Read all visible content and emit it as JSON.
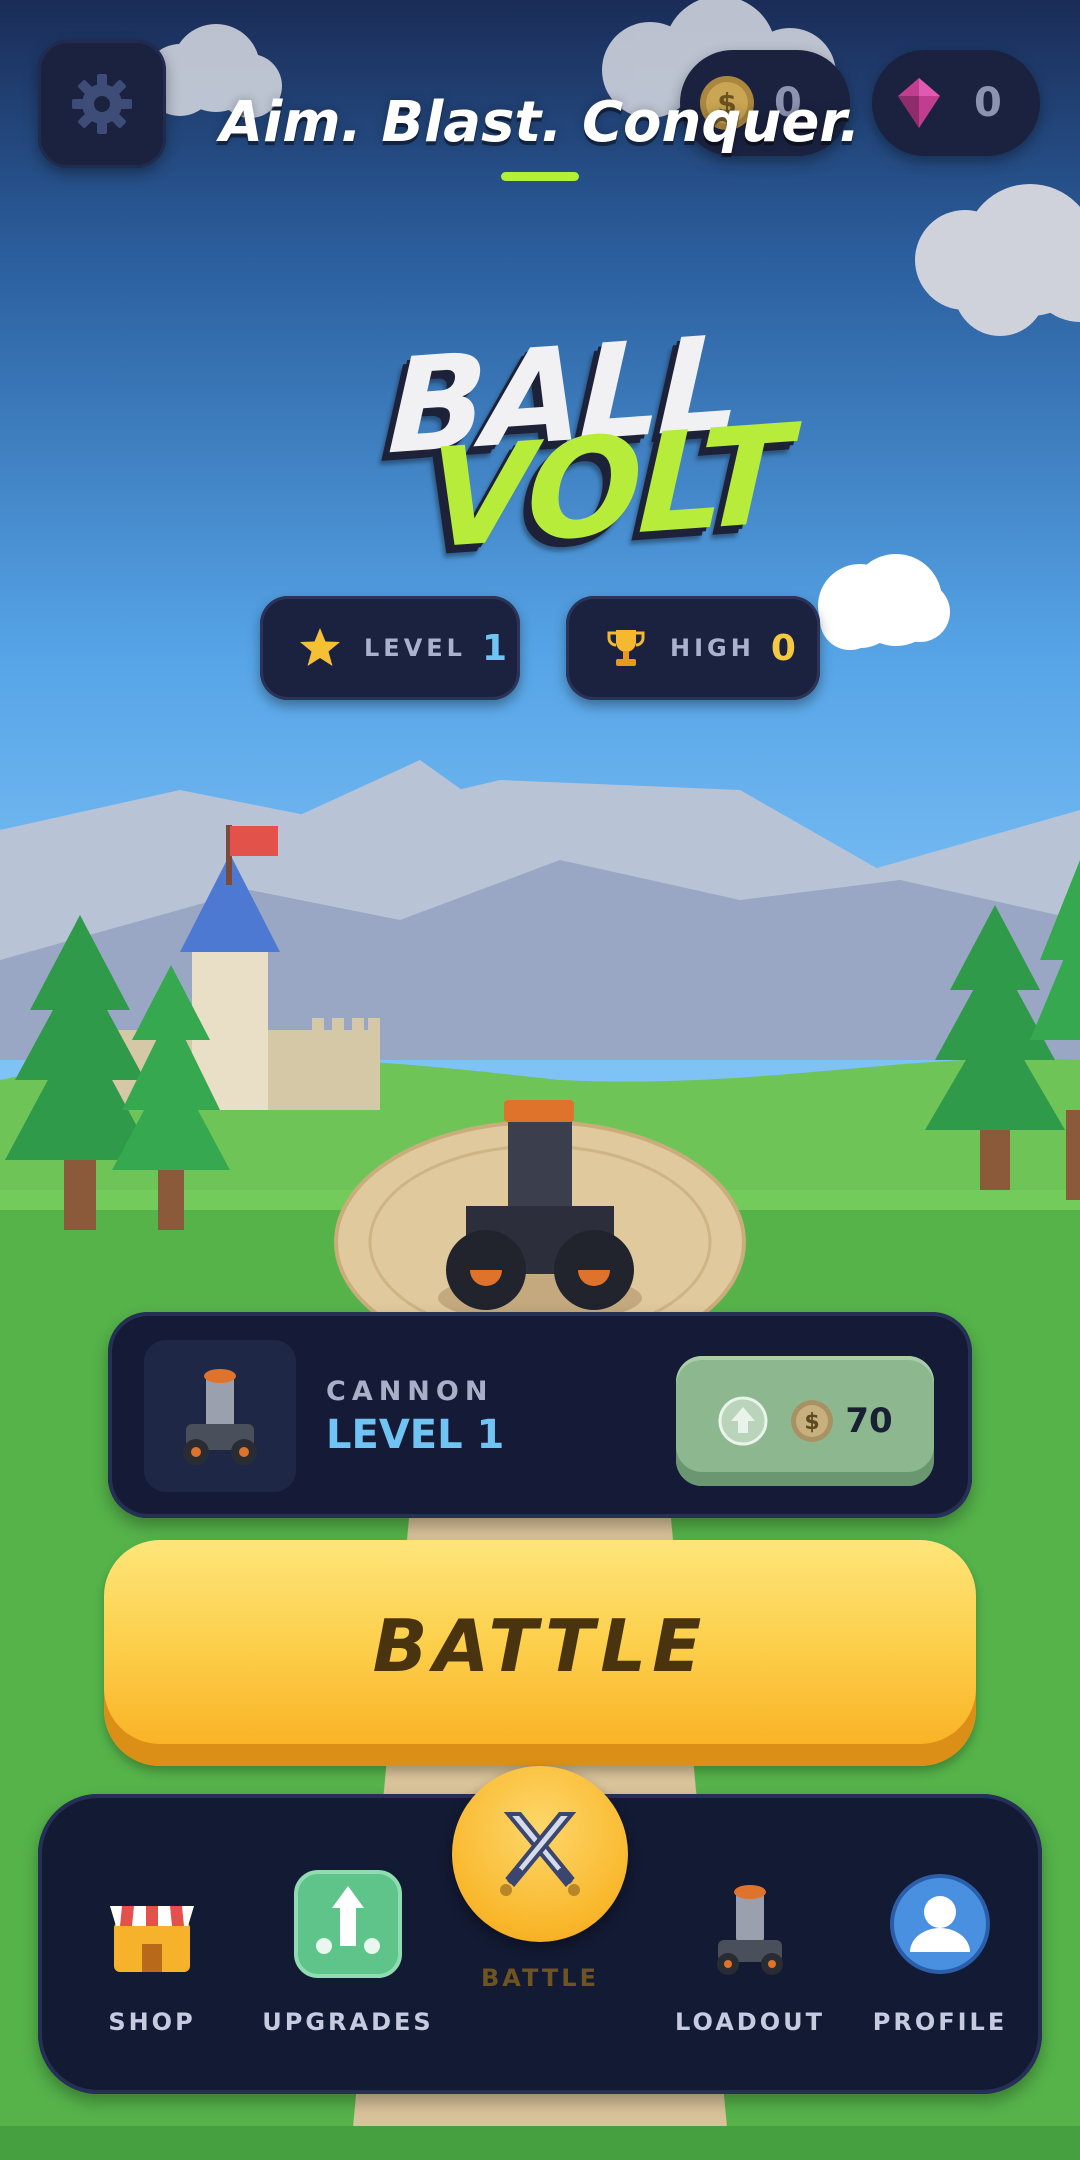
{
  "hud": {
    "coins": "0",
    "gems": "0",
    "tagline": "Aim. Blast. Conquer."
  },
  "logo": {
    "line1": "BALL",
    "line2": "VOLT"
  },
  "stats": {
    "level_label": "LEVEL",
    "level_value": "1",
    "high_label": "HIGH",
    "high_value": "0"
  },
  "upgrade_panel": {
    "caption": "CANNON",
    "level": "LEVEL 1",
    "cost": "70"
  },
  "battle_button": {
    "label": "BATTLE"
  },
  "nav": {
    "items": [
      {
        "label": "SHOP",
        "icon": "shop-icon"
      },
      {
        "label": "UPGRADES",
        "icon": "upgrade-icon"
      },
      {
        "label": "BATTLE",
        "icon": "crossed-swords-icon"
      },
      {
        "label": "LOADOUT",
        "icon": "cannon-icon"
      },
      {
        "label": "PROFILE",
        "icon": "profile-icon"
      }
    ]
  },
  "colors": {
    "accent_green": "#b4f03a",
    "panel_navy": "#151b36",
    "battle_yellow": "#fcd04c",
    "level_blue": "#6fc4f4",
    "high_gold": "#f5c842"
  }
}
